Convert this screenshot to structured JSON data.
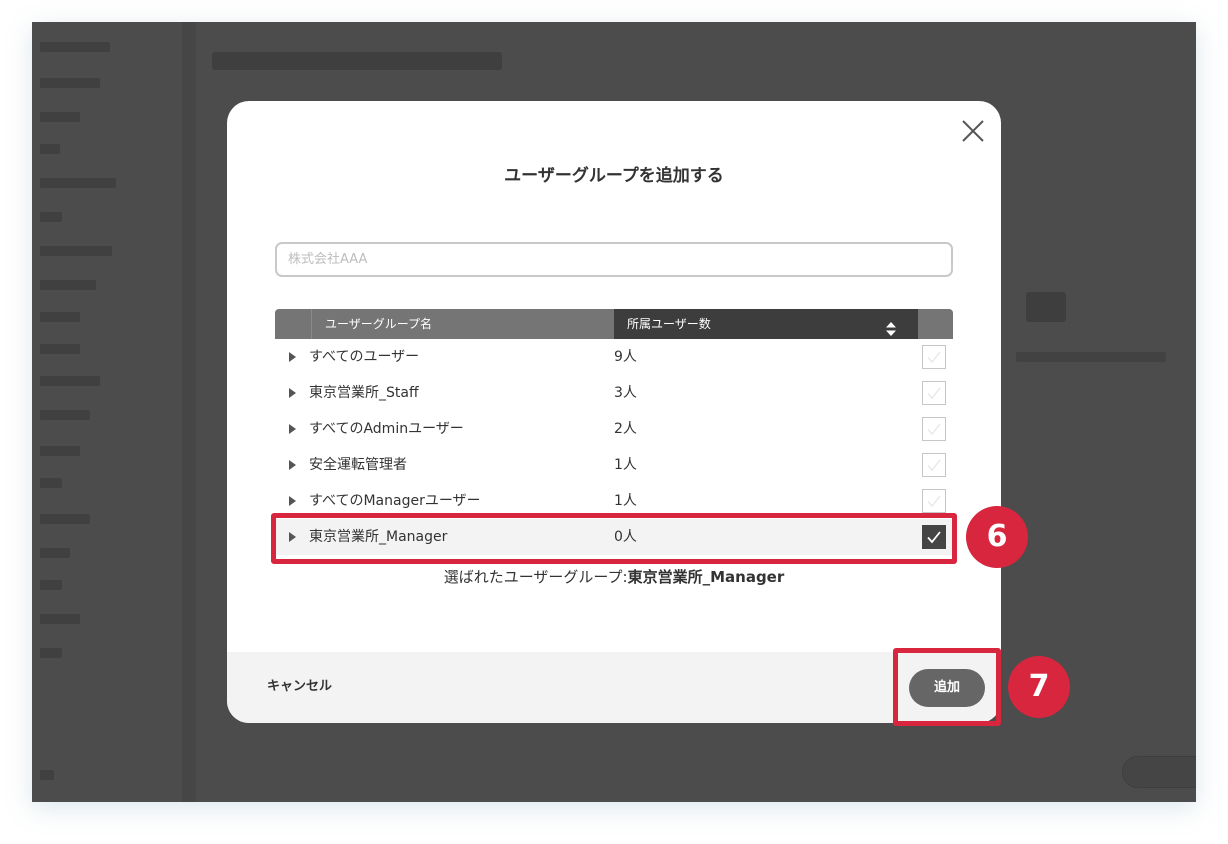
{
  "modal": {
    "title": "ユーザーグループを追加する",
    "search_placeholder": "株式会社AAA",
    "search_value": ""
  },
  "table": {
    "columns": {
      "name": "ユーザーグループ名",
      "count": "所属ユーザー数"
    },
    "rows": [
      {
        "name": "すべてのユーザー",
        "count": "9人",
        "checked": false
      },
      {
        "name": "東京営業所_Staff",
        "count": "3人",
        "checked": false
      },
      {
        "name": "すべてのAdminユーザー",
        "count": "2人",
        "checked": false
      },
      {
        "name": "安全運転管理者",
        "count": "1人",
        "checked": false
      },
      {
        "name": "すべてのManagerユーザー",
        "count": "1人",
        "checked": false
      },
      {
        "name": "東京営業所_Manager",
        "count": "0人",
        "checked": true
      }
    ]
  },
  "selection": {
    "label": "選ばれたユーザーグループ:",
    "value": "東京営業所_Manager"
  },
  "footer": {
    "cancel_label": "キャンセル",
    "add_label": "追加"
  },
  "annotations": {
    "step6": "6",
    "step7": "7"
  },
  "colors": {
    "highlight": "#d7263d",
    "header_bg": "#757575",
    "header_sorted_bg": "#3d3d3d",
    "add_button": "#666666"
  },
  "icons": [
    "close-icon",
    "sort-icon",
    "expand-triangle-icon",
    "checkmark-icon"
  ]
}
